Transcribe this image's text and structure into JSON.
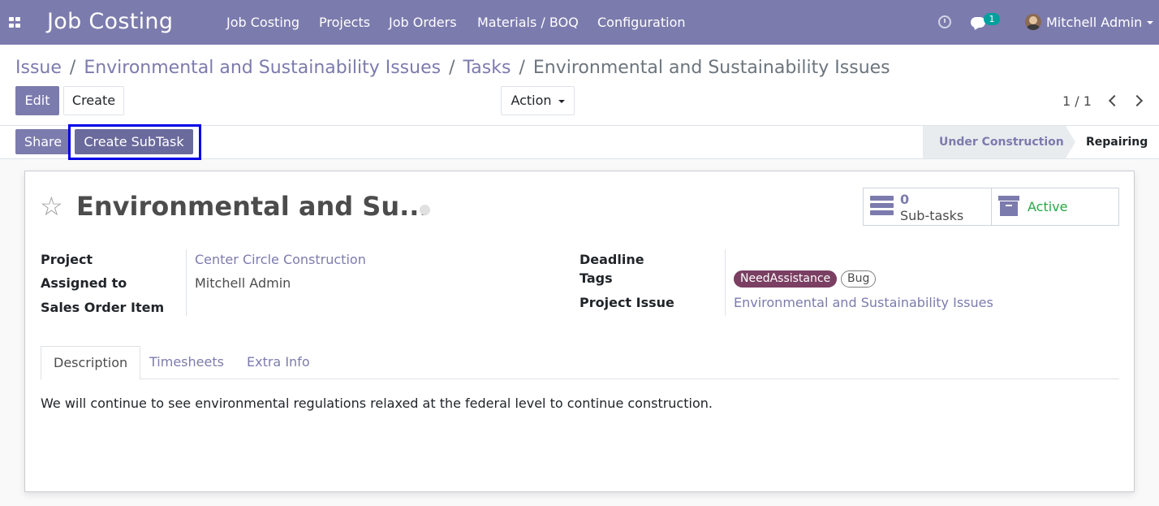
{
  "navbar": {
    "app_title": "Job Costing",
    "menu": [
      "Job Costing",
      "Projects",
      "Job Orders",
      "Materials / BOQ",
      "Configuration"
    ],
    "chat_count": "1",
    "user_name": "Mitchell Admin"
  },
  "breadcrumb": {
    "items": [
      "Issue",
      "Environmental and Sustainability Issues",
      "Tasks"
    ],
    "separator": "/",
    "current": "Environmental and Sustainability Issues"
  },
  "toolbar": {
    "edit_label": "Edit",
    "create_label": "Create",
    "action_label": "Action",
    "pager": "1 / 1"
  },
  "statusbar": {
    "share_label": "Share",
    "create_subtask_label": "Create SubTask",
    "stages": [
      "Under Construction",
      "Repairing"
    ],
    "current_stage": "Repairing"
  },
  "record": {
    "title": "Environmental and Su...",
    "subtasks_count": "0",
    "subtasks_label": "Sub-tasks",
    "active_label": "Active",
    "fields": {
      "project_label": "Project",
      "project_value": "Center Circle Construction",
      "assigned_label": "Assigned to",
      "assigned_value": "Mitchell Admin",
      "sales_order_label": "Sales Order Item",
      "deadline_label": "Deadline",
      "tags_label": "Tags",
      "tags": [
        "NeedAssistance",
        "Bug"
      ],
      "project_issue_label": "Project Issue",
      "project_issue_value": "Environmental and Sustainability Issues"
    },
    "tabs": [
      "Description",
      "Timesheets",
      "Extra Info"
    ],
    "active_tab": "Description",
    "description": "We will continue to see environmental regulations relaxed at the federal level to continue construction."
  },
  "colors": {
    "brand": "#7c7bad",
    "highlight_border": "#0000e6",
    "tag_need_assistance": "#7a3f62",
    "active_green": "#28a745"
  },
  "icons": [
    "apps-grid-icon",
    "clock-icon",
    "chat-icon",
    "avatar",
    "star-icon",
    "subtasks-icon",
    "archive-icon",
    "chevron-left-icon",
    "chevron-right-icon",
    "caret-down-icon"
  ]
}
